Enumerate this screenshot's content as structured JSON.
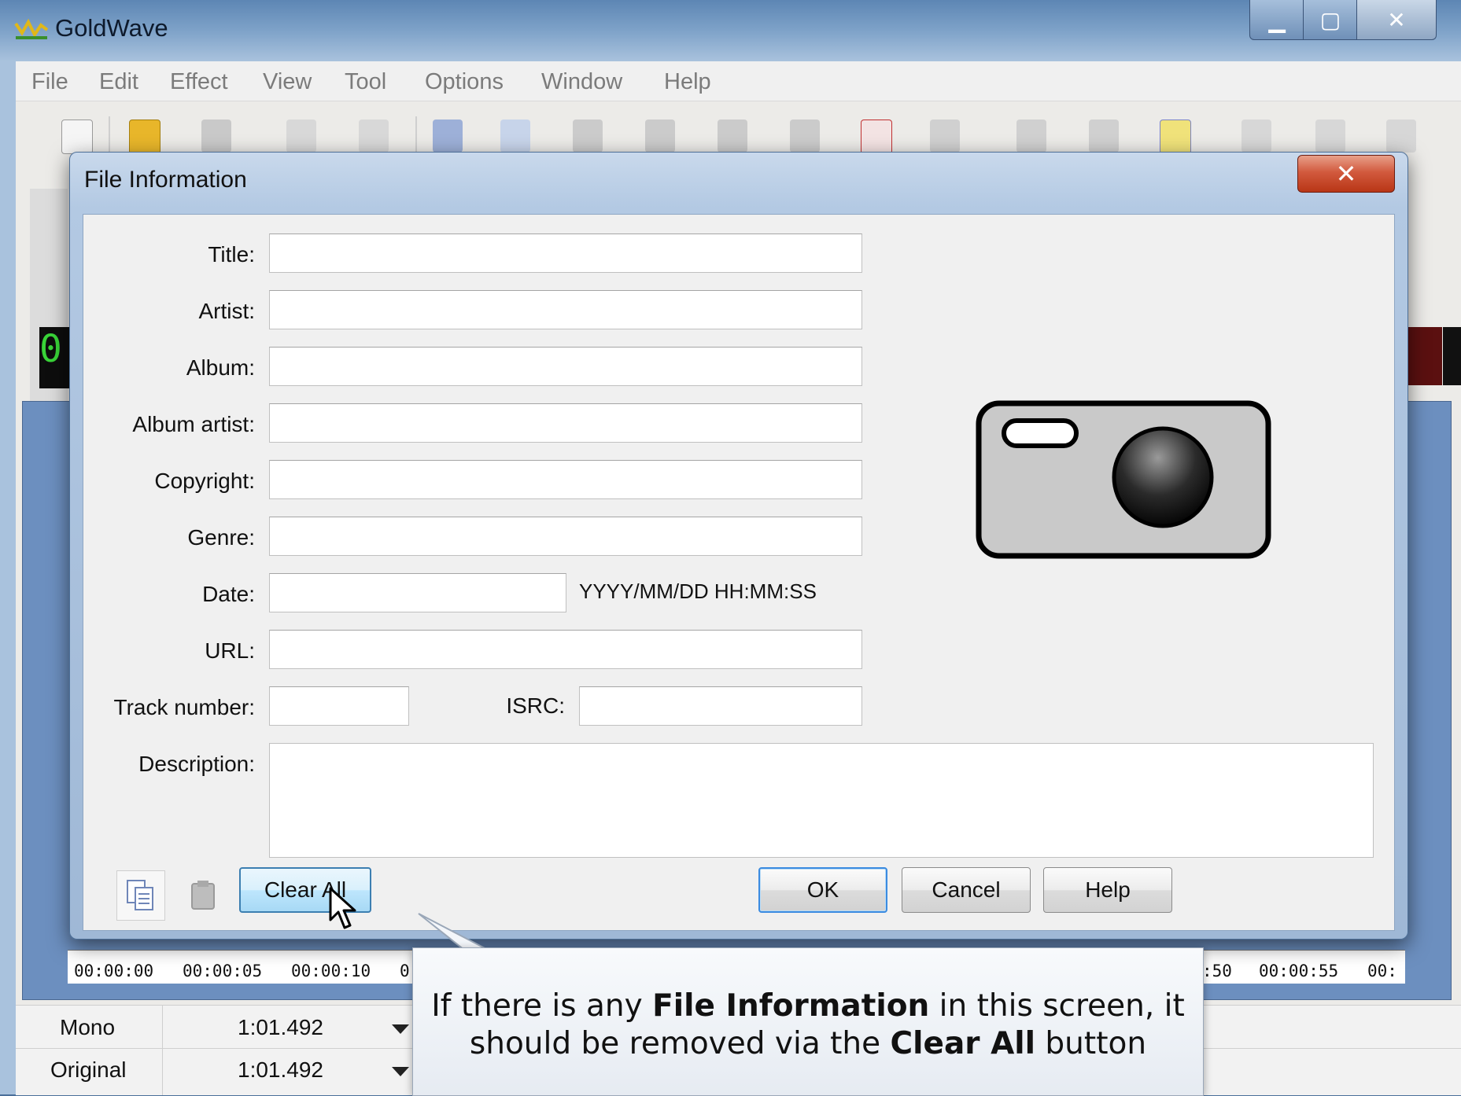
{
  "window": {
    "title": "GoldWave"
  },
  "menubar": {
    "items": [
      "File",
      "Edit",
      "Effect",
      "View",
      "Tool",
      "Options",
      "Window",
      "Help"
    ]
  },
  "background": {
    "display_digit": "0",
    "timeline_ticks": [
      "00:00:00",
      "00:00:05",
      "00:00:10",
      "0",
      ":50",
      "00:00:55",
      "00:"
    ],
    "status": {
      "row1": {
        "channel": "Mono",
        "length": "1:01.492"
      },
      "row2": {
        "mode": "Original",
        "length": "1:01.492"
      }
    }
  },
  "dialog": {
    "title": "File Information",
    "close_label": "✕",
    "fields": {
      "title": {
        "label": "Title:",
        "value": ""
      },
      "artist": {
        "label": "Artist:",
        "value": ""
      },
      "album": {
        "label": "Album:",
        "value": ""
      },
      "album_artist": {
        "label": "Album artist:",
        "value": ""
      },
      "copyright": {
        "label": "Copyright:",
        "value": ""
      },
      "genre": {
        "label": "Genre:",
        "value": ""
      },
      "date": {
        "label": "Date:",
        "value": "",
        "format_hint": "YYYY/MM/DD HH:MM:SS"
      },
      "url": {
        "label": "URL:",
        "value": ""
      },
      "track_number": {
        "label": "Track number:",
        "value": ""
      },
      "isrc": {
        "label": "ISRC:",
        "value": ""
      },
      "description": {
        "label": "Description:",
        "value": ""
      }
    },
    "buttons": {
      "clear_all": "Clear All",
      "ok": "OK",
      "cancel": "Cancel",
      "help": "Help"
    },
    "picture_icon": "camera-icon"
  },
  "callout": {
    "line1_pre": "If there is any ",
    "line1_bold": "File Information",
    "line1_post": " in this screen, it",
    "line2_pre": "should be removed via the ",
    "line2_bold": "Clear All",
    "line2_post": " button"
  },
  "colors": {
    "accent_blue": "#3b8be0",
    "close_red": "#c8472a",
    "titlebar": "#5d86b4"
  }
}
